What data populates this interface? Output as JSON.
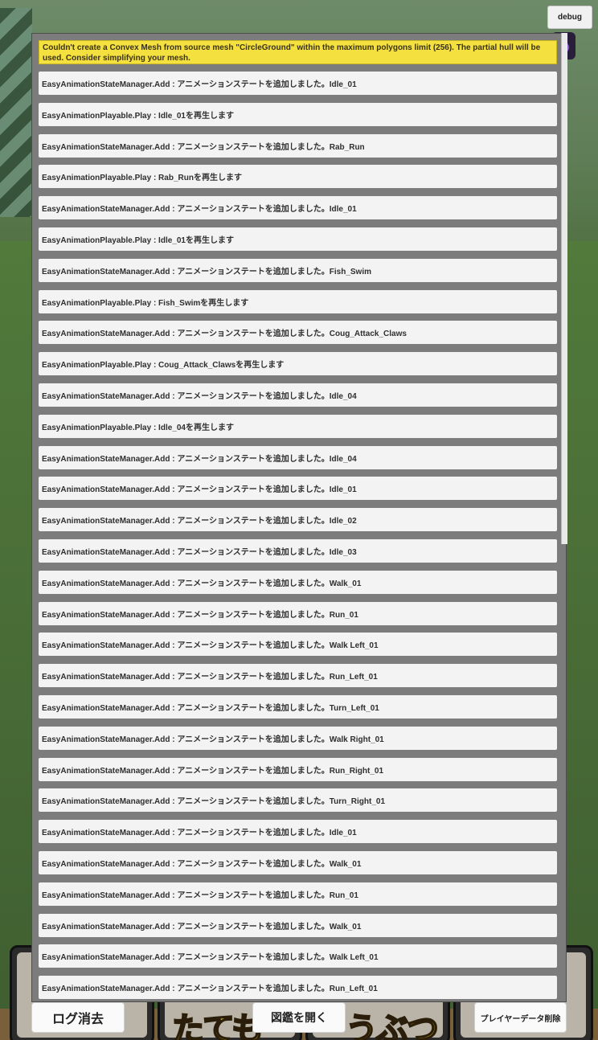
{
  "debug_button": "debug",
  "console": {
    "warning": "Couldn't create a Convex Mesh from source mesh \"CircleGround\" within the maximum polygons limit (256). The partial hull will be used. Consider simplifying your mesh.",
    "logs": [
      "EasyAnimationStateManager.Add : アニメーションステートを追加しました。Idle_01",
      "EasyAnimationPlayable.Play : Idle_01を再生します",
      "EasyAnimationStateManager.Add : アニメーションステートを追加しました。Rab_Run",
      "EasyAnimationPlayable.Play : Rab_Runを再生します",
      "EasyAnimationStateManager.Add : アニメーションステートを追加しました。Idle_01",
      "EasyAnimationPlayable.Play : Idle_01を再生します",
      "EasyAnimationStateManager.Add : アニメーションステートを追加しました。Fish_Swim",
      "EasyAnimationPlayable.Play : Fish_Swimを再生します",
      "EasyAnimationStateManager.Add : アニメーションステートを追加しました。Coug_Attack_Claws",
      "EasyAnimationPlayable.Play : Coug_Attack_Clawsを再生します",
      "EasyAnimationStateManager.Add : アニメーションステートを追加しました。Idle_04",
      "EasyAnimationPlayable.Play : Idle_04を再生します",
      "EasyAnimationStateManager.Add : アニメーションステートを追加しました。Idle_04",
      "EasyAnimationStateManager.Add : アニメーションステートを追加しました。Idle_01",
      "EasyAnimationStateManager.Add : アニメーションステートを追加しました。Idle_02",
      "EasyAnimationStateManager.Add : アニメーションステートを追加しました。Idle_03",
      "EasyAnimationStateManager.Add : アニメーションステートを追加しました。Walk_01",
      "EasyAnimationStateManager.Add : アニメーションステートを追加しました。Run_01",
      "EasyAnimationStateManager.Add : アニメーションステートを追加しました。Walk Left_01",
      "EasyAnimationStateManager.Add : アニメーションステートを追加しました。Run_Left_01",
      "EasyAnimationStateManager.Add : アニメーションステートを追加しました。Turn_Left_01",
      "EasyAnimationStateManager.Add : アニメーションステートを追加しました。Walk Right_01",
      "EasyAnimationStateManager.Add : アニメーションステートを追加しました。Run_Right_01",
      "EasyAnimationStateManager.Add : アニメーションステートを追加しました。Turn_Right_01",
      "EasyAnimationStateManager.Add : アニメーションステートを追加しました。Idle_01",
      "EasyAnimationStateManager.Add : アニメーションステートを追加しました。Walk_01",
      "EasyAnimationStateManager.Add : アニメーションステートを追加しました。Run_01",
      "EasyAnimationStateManager.Add : アニメーションステートを追加しました。Walk_01",
      "EasyAnimationStateManager.Add : アニメーションステートを追加しました。Walk Left_01",
      "EasyAnimationStateManager.Add : アニメーションステートを追加しました。Run_Left_01"
    ]
  },
  "footer": {
    "clear_log": "ログ消去",
    "open_encyclopedia": "図鑑を開く",
    "delete_player_data": "プレイヤーデータ削除"
  },
  "background_hud": {
    "word_buildings": "たても",
    "word_animals": "うぶつ"
  }
}
